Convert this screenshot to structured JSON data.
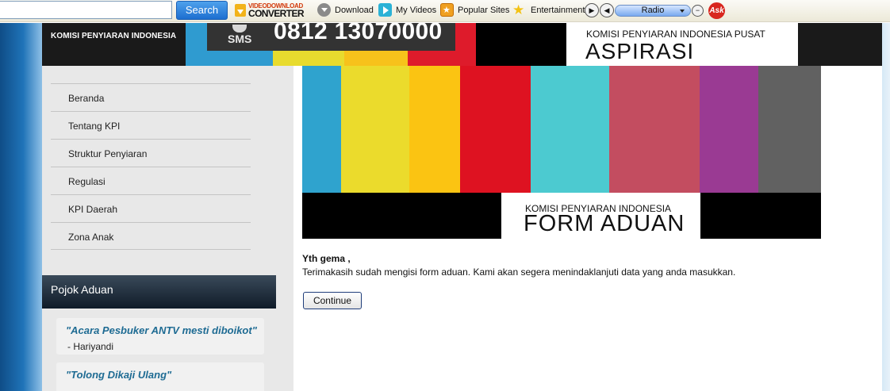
{
  "toolbar": {
    "search_placeholder": "",
    "search_label": "Search",
    "vdc_top": "VIDEODOWNLOAD",
    "vdc_bottom": "CONVERTER",
    "download_label": "Download",
    "videos_label": "My Videos",
    "sites_label": "Popular Sites",
    "entertainment_label": "Entertainment",
    "radio_label": "Radio",
    "ask_label": "Ask"
  },
  "header": {
    "logo_text": "KOMISI PENYIARAN INDONESIA",
    "sms_label": "SMS",
    "sms_number": "0812 13070000",
    "aspirasi_sub": "KOMISI PENYIARAN INDONESIA PUSAT",
    "aspirasi_main": "ASPIRASI",
    "stripe_colors": [
      "#2f9bd0",
      "#e8db2e",
      "#f7c21b",
      "#de1b2b",
      "#46c6cd",
      "#c24a5e",
      "#9c3b92",
      "#606060"
    ]
  },
  "nav": {
    "items": [
      {
        "label": "Beranda"
      },
      {
        "label": "Tentang KPI"
      },
      {
        "label": "Struktur Penyiaran"
      },
      {
        "label": "Regulasi"
      },
      {
        "label": "KPI Daerah"
      },
      {
        "label": "Zona Anak"
      }
    ]
  },
  "pojok": {
    "title": "Pojok Aduan",
    "items": [
      {
        "quote": "\"Acara Pesbuker ANTV mesti diboikot\"",
        "author": "- Hariyandi"
      },
      {
        "quote": "\"Tolong Dikaji Ulang\"",
        "author": ""
      }
    ]
  },
  "main": {
    "banner_sub": "KOMISI PENYIARAN INDONESIA",
    "banner_main": "FORM ADUAN",
    "bar_colors": [
      "#2fa3ce",
      "#ebdb2c",
      "#fbc412",
      "#de1221",
      "#4ccad0",
      "#c34d60",
      "#9a3a93",
      "#616161"
    ],
    "greeting": "Yth gema ,",
    "message": "Terimakasih sudah mengisi form aduan. Kami akan segera menindaklanjuti data yang anda masukkan.",
    "continue_label": "Continue"
  }
}
